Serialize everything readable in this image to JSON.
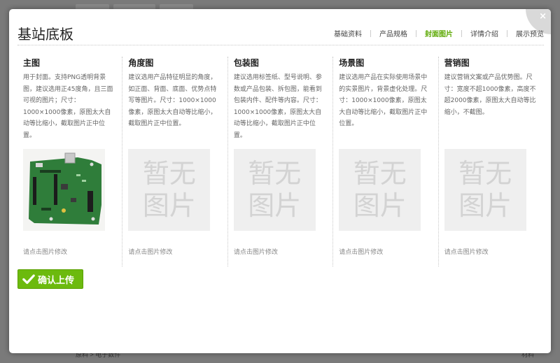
{
  "modal": {
    "title": "基站底板",
    "close_label": "×",
    "steps": [
      {
        "label": "基础资料",
        "active": false
      },
      {
        "label": "产品规格",
        "active": false
      },
      {
        "label": "封面图片",
        "active": true
      },
      {
        "label": "详情介绍",
        "active": false
      },
      {
        "label": "展示预览",
        "active": false
      }
    ],
    "columns": [
      {
        "title": "主图",
        "desc": "用于封面。支持PNG透明背景图，建议选用正45度角，且三面可视的图片；尺寸：1000×1000像素，原图太大自动等比缩小，截取图片正中位置。",
        "has_image": true,
        "hint": "请点击图片修改"
      },
      {
        "title": "角度图",
        "desc": "建议选用产品特征明显的角度，如正面、背面、底面、优势点特写等图片。尺寸：1000×1000像素，原图太大自动等比缩小，截取图片正中位置。",
        "has_image": false,
        "placeholder": "暂无图片",
        "hint": "请点击图片修改"
      },
      {
        "title": "包装图",
        "desc": "建议选用标签纸、型号说明、参数或产品包装、拆包图，能看到包装内件、配件等内容。尺寸：1000×1000像素，原图太大自动等比缩小，截取图片正中位置。",
        "has_image": false,
        "placeholder": "暂无图片",
        "hint": "请点击图片修改"
      },
      {
        "title": "场景图",
        "desc": "建议选用产品在实际使用场景中的实景图片，背景虚化处理。尺寸：1000×1000像素，原图太大自动等比缩小，截取图片正中位置。",
        "has_image": false,
        "placeholder": "暂无图片",
        "hint": "请点击图片修改"
      },
      {
        "title": "营销图",
        "desc": "建议营销文案或产品优势图。尺寸：宽度不超1000像素，高度不超2000像素，原图太大自动等比缩小，不截图。",
        "has_image": false,
        "placeholder": "暂无图片",
        "hint": "请点击图片修改"
      }
    ],
    "confirm_label": "确认上传"
  },
  "background": {
    "breadcrumb": "原料 > 电子数件",
    "right_label": "材料"
  },
  "colors": {
    "accent_green": "#6cba0e",
    "active_step": "#5aa800"
  }
}
